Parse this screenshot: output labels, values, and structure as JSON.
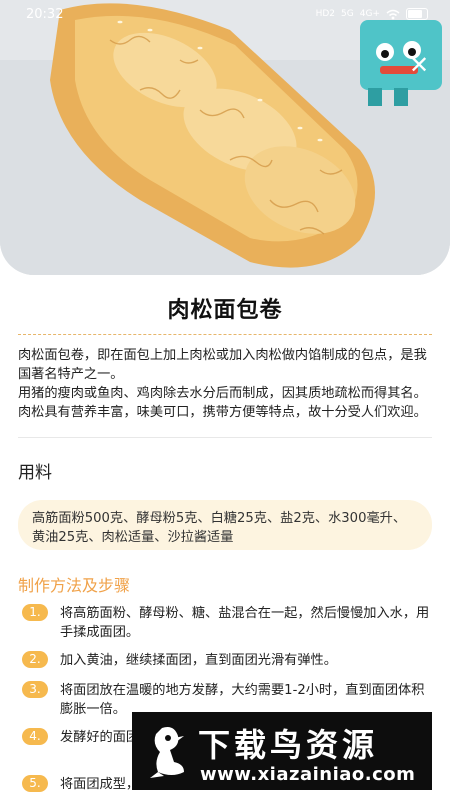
{
  "status_bar": {
    "time": "20:32",
    "network_1": "HD2",
    "network_2": "5G",
    "network_3": "4G+",
    "wifi_icon": "wifi-icon",
    "battery_icon": "battery-icon"
  },
  "close_glyph": "✕",
  "recipe": {
    "title": "肉松面包卷",
    "description": [
      "肉松面包卷，即在面包上加上肉松或加入肉松做内馅制成的包点，是我国著名特产之一。",
      "用猪的瘦肉或鱼肉、鸡肉除去水分后而制成，因其质地疏松而得其名。肉松具有营养丰富，味美可口，携带方便等特点，故十分受人们欢迎。"
    ],
    "ingredients_heading": "用料",
    "ingredients": "高筋面粉500克、酵母粉5克、白糖25克、盐2克、水300毫升、黄油25克、肉松适量、沙拉酱适量",
    "steps_heading": "制作方法及步骤",
    "steps": [
      {
        "num": "1.",
        "text": "将高筋面粉、酵母粉、糖、盐混合在一起，然后慢慢加入水，用手揉成面团。"
      },
      {
        "num": "2.",
        "text": "加入黄油，继续揉面团，直到面团光滑有弹性。"
      },
      {
        "num": "3.",
        "text": "将面团放在温暖的地方发酵，大约需要1-2小时，直到面团体积膨胀一倍。"
      },
      {
        "num": "4.",
        "text": "发酵好的面团排气，分成小面团揉圆"
      },
      {
        "num": "5.",
        "text": "将面团成型，将卷好的面团放在烤盘上"
      }
    ]
  },
  "watermark": {
    "title": "下载鸟资源",
    "url": "www.xiazainiao.com"
  },
  "colors": {
    "accent": "#f0a24a",
    "badge": "#f6b94e",
    "ingredient_bg": "#fdf4e0"
  }
}
